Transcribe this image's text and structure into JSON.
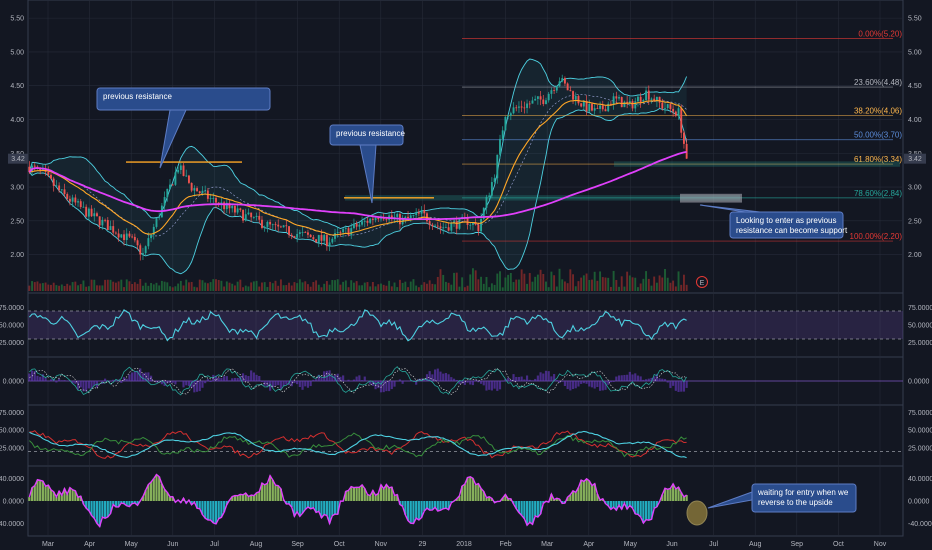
{
  "chart_data": [
    {
      "type": "candlestick",
      "panel": "price",
      "yticks": [
        "5.50",
        "5.00",
        "4.50",
        "4.00",
        "3.50",
        "3.00",
        "2.50",
        "2.00"
      ],
      "ylim": [
        1.55,
        5.65
      ],
      "last_price_label": "3.42",
      "xticks": [
        "Mar",
        "Apr",
        "May",
        "Jun",
        "Jul",
        "Aug",
        "Sep",
        "Oct",
        "Nov",
        "29",
        "2018",
        "Feb",
        "Mar",
        "Apr",
        "May",
        "Jun",
        "Jul",
        "Aug",
        "Sep",
        "Oct",
        "Nov"
      ],
      "path": [
        [
          0,
          3.3
        ],
        [
          5,
          3.2
        ],
        [
          12,
          2.9
        ],
        [
          22,
          2.6
        ],
        [
          30,
          2.4
        ],
        [
          38,
          2.2
        ],
        [
          42,
          2.0
        ],
        [
          48,
          2.6
        ],
        [
          55,
          3.3
        ],
        [
          60,
          3.0
        ],
        [
          68,
          2.8
        ],
        [
          78,
          2.6
        ],
        [
          90,
          2.4
        ],
        [
          100,
          2.3
        ],
        [
          110,
          2.2
        ],
        [
          120,
          2.4
        ],
        [
          130,
          2.6
        ],
        [
          138,
          2.5
        ],
        [
          145,
          2.6
        ],
        [
          152,
          2.4
        ],
        [
          162,
          2.5
        ],
        [
          166,
          2.4
        ],
        [
          172,
          3.2
        ],
        [
          176,
          4.1
        ],
        [
          182,
          4.2
        ],
        [
          190,
          4.3
        ],
        [
          196,
          4.6
        ],
        [
          200,
          4.4
        ],
        [
          205,
          4.2
        ],
        [
          210,
          4.1
        ],
        [
          216,
          4.3
        ],
        [
          222,
          4.2
        ],
        [
          228,
          4.4
        ],
        [
          234,
          4.2
        ],
        [
          240,
          4.1
        ],
        [
          243,
          3.42
        ]
      ],
      "bars_total": 244,
      "fib_levels": [
        {
          "label": "0.00%(5.20)",
          "value": 5.2,
          "color": "#e53935"
        },
        {
          "label": "23.60%(4.48)",
          "value": 4.48,
          "color": "#b2b5be"
        },
        {
          "label": "38.20%(4.06)",
          "value": 4.06,
          "color": "#ffb74d"
        },
        {
          "label": "50.00%(3.70)",
          "value": 3.7,
          "color": "#5c8ddb"
        },
        {
          "label": "61.80%(3.34)",
          "value": 3.34,
          "color": "#ffb74d"
        },
        {
          "label": "78.60%(2.84)",
          "value": 2.84,
          "color": "#26a69a"
        },
        {
          "label": "100.00%(2.20)",
          "value": 2.2,
          "color": "#e53935"
        }
      ],
      "annotations": [
        {
          "text": [
            "previous resistance"
          ]
        },
        {
          "text": [
            "previous resistance"
          ]
        },
        {
          "text": [
            "Looking to enter as previous",
            "resistance can become support"
          ]
        },
        {
          "text": [
            "waiting for entry when we",
            "reverse to the upside"
          ]
        }
      ],
      "resistance_lines": [
        3.37,
        2.84
      ],
      "event_marker": "E"
    },
    {
      "type": "line",
      "panel": "rsi",
      "yticks": [
        "75.0000",
        "50.0000",
        "25.0000"
      ],
      "ylim": [
        10,
        90
      ]
    },
    {
      "type": "line",
      "panel": "oscillator",
      "yticks": [
        "0.0000"
      ],
      "ylim": [
        -1,
        1
      ]
    },
    {
      "type": "line",
      "panel": "dmi",
      "yticks": [
        "75.0000",
        "50.0000",
        "25.0000"
      ],
      "ylim": [
        5,
        80
      ]
    },
    {
      "type": "bar",
      "panel": "histogram",
      "yticks": [
        "40.0000",
        "0.0000",
        "-40.0000"
      ],
      "ylim": [
        -55,
        55
      ]
    }
  ],
  "colors": {
    "bg": "#131722",
    "grid": "#262b38",
    "text": "#b2b5be",
    "up": "#26a69a",
    "down": "#ef5350",
    "bb": "#4dd0e1",
    "sma": "#e040fb",
    "ema": "#ffa726",
    "rsi": "#4dd0e1",
    "note_bg": "#2a4c8c",
    "note_border": "#5d7cc4"
  }
}
